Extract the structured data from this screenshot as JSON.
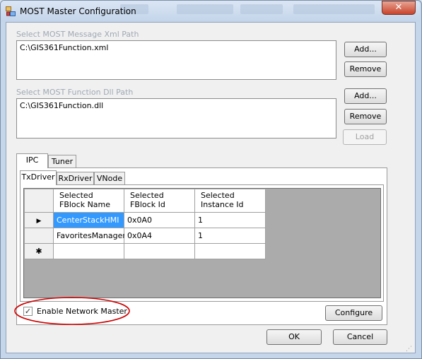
{
  "window": {
    "title": "MOST Master Configuration",
    "close_glyph": "✕",
    "app_icon": "app-window-icon"
  },
  "xml_section": {
    "label": "Select MOST Message Xml Path",
    "path": "C:\\GIS361Function.xml",
    "add_label": "Add...",
    "remove_label": "Remove"
  },
  "dll_section": {
    "label": "Select MOST Function Dll Path",
    "path": "C:\\GIS361Function.dll",
    "add_label": "Add...",
    "remove_label": "Remove",
    "load_label": "Load"
  },
  "outer_tabs": [
    "IPC",
    "Tuner"
  ],
  "inner_tabs": [
    "TxDriver",
    "RxDriver",
    "VNode"
  ],
  "grid": {
    "headers": [
      "Selected\nFBlock Name",
      "Selected\nFBlock Id",
      "Selected\nInstance Id"
    ],
    "rows": [
      {
        "name": "CenterStackHMI",
        "fblock_id": "0x0A0",
        "instance_id": "1"
      },
      {
        "name": "FavoritesManager",
        "fblock_id": "0x0A4",
        "instance_id": "1"
      }
    ],
    "current_row_marker": "▶",
    "new_row_marker": "✱"
  },
  "enable_network_master": {
    "label": "Enable Network Master",
    "checked": true,
    "check_glyph": "✓"
  },
  "buttons": {
    "configure_label": "Configure",
    "ok_label": "OK",
    "cancel_label": "Cancel"
  },
  "colors": {
    "selected_cell_bg": "#3399ff",
    "annotation_circle": "#cc0000"
  }
}
